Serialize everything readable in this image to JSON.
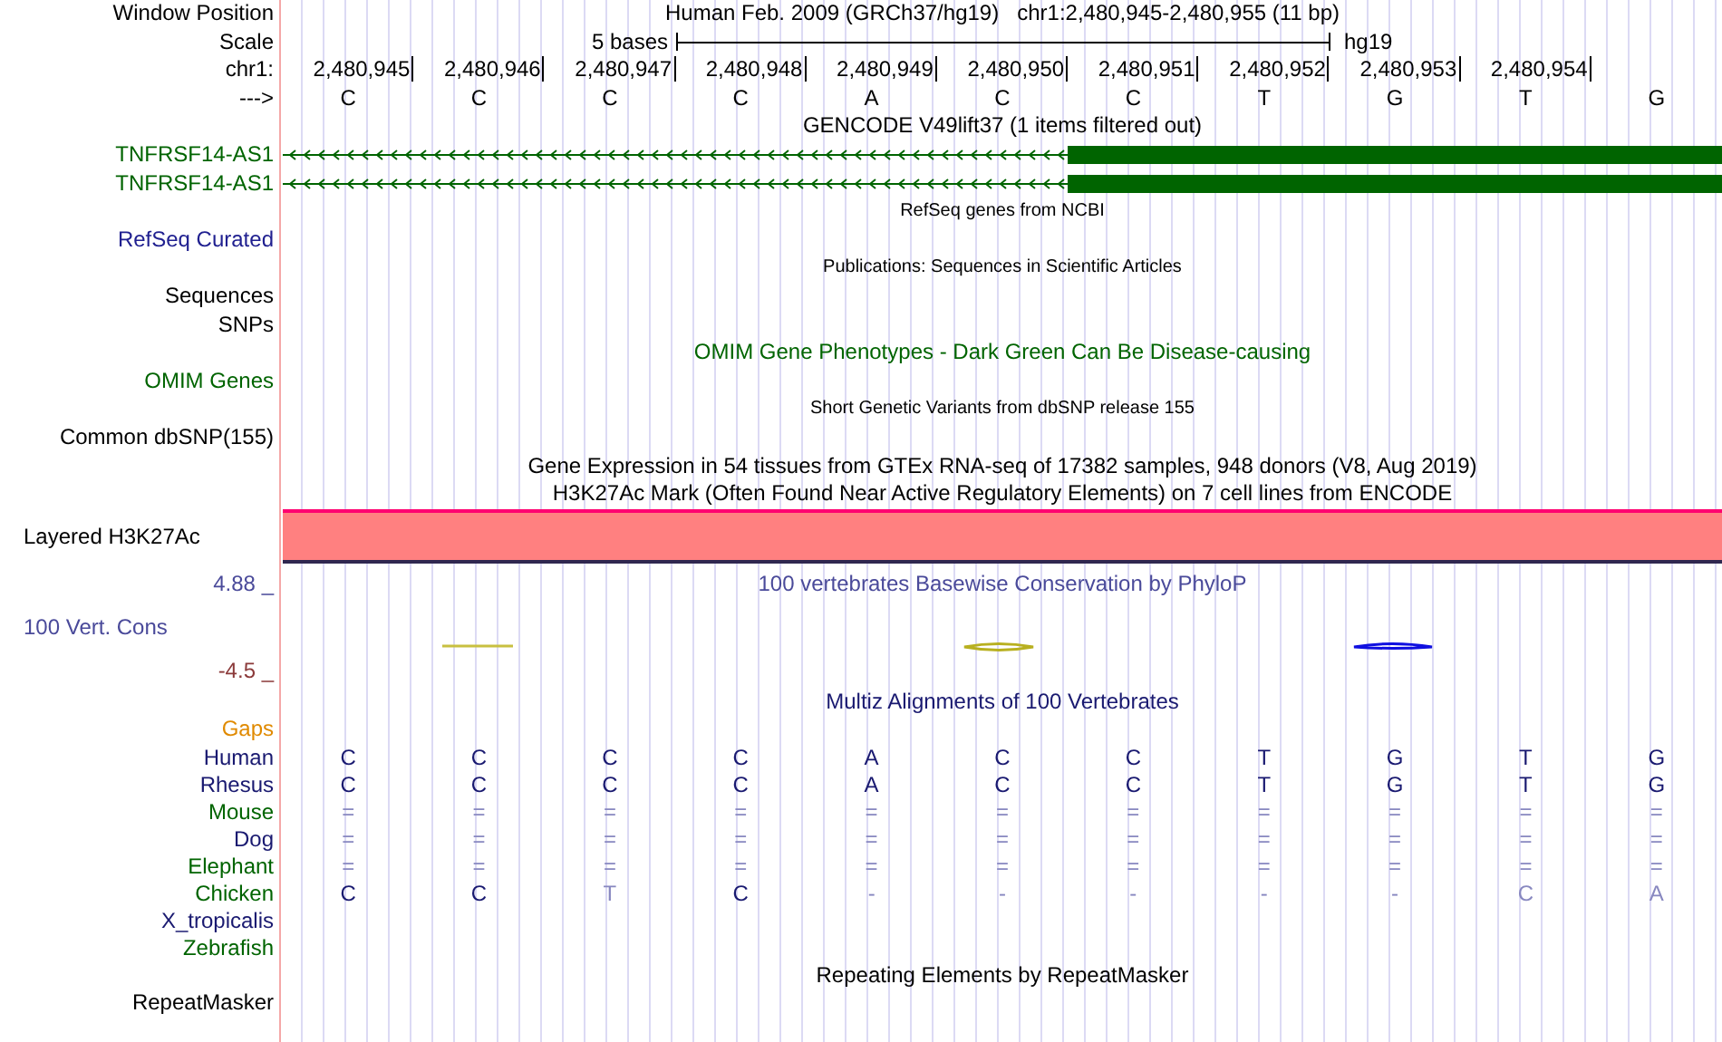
{
  "position": {
    "label": "Window Position",
    "assembly": "Human Feb. 2009 (GRCh37/hg19)",
    "range": "chr1:2,480,945-2,480,955 (11 bp)"
  },
  "scale": {
    "label": "Scale",
    "size": "5 bases",
    "database": "hg19"
  },
  "ruler": {
    "label": "chr1:",
    "positions": [
      "2,480,945",
      "2,480,946",
      "2,480,947",
      "2,480,948",
      "2,480,949",
      "2,480,950",
      "2,480,951",
      "2,480,952",
      "2,480,953",
      "2,480,954"
    ]
  },
  "sequence": {
    "label": "--->",
    "bases": [
      "C",
      "C",
      "C",
      "C",
      "A",
      "C",
      "C",
      "T",
      "G",
      "T",
      "G"
    ]
  },
  "tracks": [
    {
      "kind": "title",
      "text": "GENCODE V49lift37 (1 items filtered out)",
      "color": "#000000"
    },
    {
      "kind": "gene",
      "label": "TNFRSF14-AS1",
      "color": "#006400"
    },
    {
      "kind": "gene",
      "label": "TNFRSF14-AS1",
      "color": "#006400"
    },
    {
      "kind": "caption",
      "text": "RefSeq genes from NCBI"
    },
    {
      "kind": "label",
      "label": "RefSeq Curated",
      "color": "#202090"
    },
    {
      "kind": "caption",
      "text": "Publications: Sequences in Scientific Articles"
    },
    {
      "kind": "label",
      "label": "Sequences",
      "color": "#000000"
    },
    {
      "kind": "label",
      "label": "SNPs",
      "color": "#000000"
    },
    {
      "kind": "title",
      "text": "OMIM Gene Phenotypes - Dark Green Can Be Disease-causing",
      "color": "#006400"
    },
    {
      "kind": "label",
      "label": "OMIM Genes",
      "color": "#006400"
    },
    {
      "kind": "caption",
      "text": "Short Genetic Variants from dbSNP release 155"
    },
    {
      "kind": "label",
      "label": "Common dbSNP(155)",
      "color": "#000000"
    },
    {
      "kind": "title",
      "text": "Gene Expression in 54 tissues from GTEx RNA-seq of 17382 samples, 948 donors (V8, Aug 2019)",
      "color": "#000000"
    },
    {
      "kind": "title",
      "text": "H3K27Ac Mark (Often Found Near Active Regulatory Elements) on 7 cell lines from ENCODE",
      "color": "#000000"
    },
    {
      "kind": "band",
      "label": "Layered H3K27Ac"
    },
    {
      "kind": "wiggle",
      "title": "100 vertebrates Basewise Conservation by PhyloP",
      "label": "100 Vert. Cons",
      "max": "4.88 _",
      "min": "-4.5 _"
    },
    {
      "kind": "title",
      "text": "Multiz Alignments of 100 Vertebrates",
      "color": "#191970"
    },
    {
      "kind": "label",
      "label": "Gaps",
      "color": "#e08a00"
    },
    {
      "kind": "species",
      "label": "Human",
      "color": "#191970",
      "bases": [
        {
          "base": "C",
          "faded": false
        },
        {
          "base": "C",
          "faded": false
        },
        {
          "base": "C",
          "faded": false
        },
        {
          "base": "C",
          "faded": false
        },
        {
          "base": "A",
          "faded": false
        },
        {
          "base": "C",
          "faded": false
        },
        {
          "base": "C",
          "faded": false
        },
        {
          "base": "T",
          "faded": false
        },
        {
          "base": "G",
          "faded": false
        },
        {
          "base": "T",
          "faded": false
        },
        {
          "base": "G",
          "faded": false
        }
      ]
    },
    {
      "kind": "species",
      "label": "Rhesus",
      "color": "#191970",
      "bases": [
        {
          "base": "C",
          "faded": false
        },
        {
          "base": "C",
          "faded": false
        },
        {
          "base": "C",
          "faded": false
        },
        {
          "base": "C",
          "faded": false
        },
        {
          "base": "A",
          "faded": false
        },
        {
          "base": "C",
          "faded": false
        },
        {
          "base": "C",
          "faded": false
        },
        {
          "base": "T",
          "faded": false
        },
        {
          "base": "G",
          "faded": false
        },
        {
          "base": "T",
          "faded": false
        },
        {
          "base": "G",
          "faded": false
        }
      ]
    },
    {
      "kind": "species",
      "label": "Mouse",
      "color": "#006400",
      "bases": [
        {
          "base": "=",
          "faded": true
        },
        {
          "base": "=",
          "faded": true
        },
        {
          "base": "=",
          "faded": true
        },
        {
          "base": "=",
          "faded": true
        },
        {
          "base": "=",
          "faded": true
        },
        {
          "base": "=",
          "faded": true
        },
        {
          "base": "=",
          "faded": true
        },
        {
          "base": "=",
          "faded": true
        },
        {
          "base": "=",
          "faded": true
        },
        {
          "base": "=",
          "faded": true
        },
        {
          "base": "=",
          "faded": true
        }
      ]
    },
    {
      "kind": "species",
      "label": "Dog",
      "color": "#191970",
      "bases": [
        {
          "base": "=",
          "faded": true
        },
        {
          "base": "=",
          "faded": true
        },
        {
          "base": "=",
          "faded": true
        },
        {
          "base": "=",
          "faded": true
        },
        {
          "base": "=",
          "faded": true
        },
        {
          "base": "=",
          "faded": true
        },
        {
          "base": "=",
          "faded": true
        },
        {
          "base": "=",
          "faded": true
        },
        {
          "base": "=",
          "faded": true
        },
        {
          "base": "=",
          "faded": true
        },
        {
          "base": "=",
          "faded": true
        }
      ]
    },
    {
      "kind": "species",
      "label": "Elephant",
      "color": "#006400",
      "bases": [
        {
          "base": "=",
          "faded": true
        },
        {
          "base": "=",
          "faded": true
        },
        {
          "base": "=",
          "faded": true
        },
        {
          "base": "=",
          "faded": true
        },
        {
          "base": "=",
          "faded": true
        },
        {
          "base": "=",
          "faded": true
        },
        {
          "base": "=",
          "faded": true
        },
        {
          "base": "=",
          "faded": true
        },
        {
          "base": "=",
          "faded": true
        },
        {
          "base": "=",
          "faded": true
        },
        {
          "base": "=",
          "faded": true
        }
      ]
    },
    {
      "kind": "species",
      "label": "Chicken",
      "color": "#006400",
      "bases": [
        {
          "base": "C",
          "faded": false
        },
        {
          "base": "C",
          "faded": false
        },
        {
          "base": "T",
          "faded": true
        },
        {
          "base": "C",
          "faded": false
        },
        {
          "base": "-",
          "faded": true
        },
        {
          "base": "-",
          "faded": true
        },
        {
          "base": "-",
          "faded": true
        },
        {
          "base": "-",
          "faded": true
        },
        {
          "base": "-",
          "faded": true
        },
        {
          "base": "C",
          "faded": true
        },
        {
          "base": "A",
          "faded": true
        }
      ]
    },
    {
      "kind": "species",
      "label": "X_tropicalis",
      "color": "#191970"
    },
    {
      "kind": "species",
      "label": "Zebrafish",
      "color": "#006400"
    },
    {
      "kind": "title",
      "text": "Repeating Elements by RepeatMasker",
      "color": "#000000"
    },
    {
      "kind": "label",
      "label": "RepeatMasker",
      "color": "#000000"
    }
  ]
}
